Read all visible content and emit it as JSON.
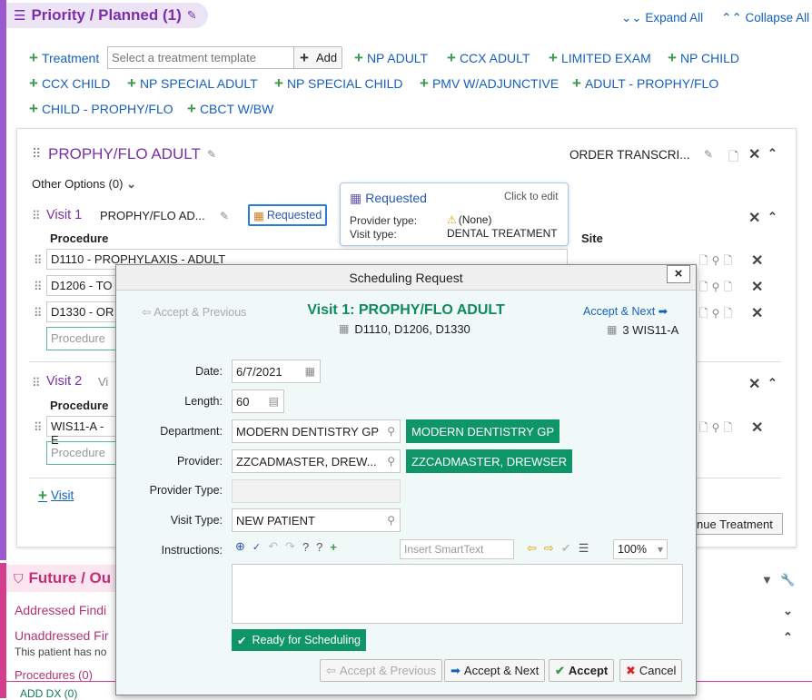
{
  "header": {
    "title": "Priority / Planned (1)",
    "expand_all": "Expand All",
    "collapse_all": "Collapse All"
  },
  "treatment": {
    "label": "Treatment",
    "placeholder": "Select a treatment template",
    "add": "Add"
  },
  "templates": [
    "NP ADULT",
    "CCX ADULT",
    "LIMITED EXAM",
    "NP CHILD",
    "CCX CHILD",
    "NP SPECIAL ADULT",
    "NP SPECIAL CHILD",
    "PMV W/ADJUNCTIVE",
    "ADULT - PROPHY/FLO",
    "CHILD - PROPHY/FLO",
    "CBCT W/BW"
  ],
  "plan": {
    "title": "PROPHY/FLO ADULT",
    "order": "ORDER TRANSCRI...",
    "other_options": "Other Options (0)"
  },
  "visit1": {
    "label": "Visit 1",
    "name": "PROPHY/FLO AD...",
    "requested": "Requested",
    "col_procedure": "Procedure",
    "col_site": "Site",
    "procedures": [
      "D1110 - PROPHYLAXIS - ADULT",
      "D1206 - TO",
      "D1330 - OR"
    ],
    "procedure_placeholder": "Procedure"
  },
  "popover": {
    "title": "Requested",
    "hint": "Click to edit",
    "provider_type_label": "Provider type:",
    "provider_type_value": "(None)",
    "visit_type_label": "Visit type:",
    "visit_type_value": "DENTAL TREATMENT"
  },
  "visit2": {
    "label": "Visit 2",
    "partial": "Vi",
    "col_procedure": "Procedure",
    "proc": "WIS11-A - E",
    "procedure_placeholder": "Procedure"
  },
  "add_visit": "Visit",
  "continue_treatment": "nue Treatment",
  "future": {
    "title": "Future / Ou",
    "addressed": "Addressed Findi",
    "unaddressed": "Unaddressed Fir",
    "note": "This patient has no",
    "procedures": "Procedures (0)",
    "add_dx": "ADD DX (0)"
  },
  "dialog": {
    "title": "Scheduling Request",
    "close": "×",
    "accept_prev": "Accept & Previous",
    "visit_title": "Visit 1: PROPHY/FLO ADULT",
    "codes": "D1110, D1206, D1330",
    "accept_next": "Accept & Next",
    "site": "3 WIS11-A",
    "date_label": "Date:",
    "date": "6/7/2021",
    "length_label": "Length:",
    "length": "60",
    "department_label": "Department:",
    "department": "MODERN DENTISTRY GP",
    "department_chip": "MODERN DENTISTRY GP",
    "provider_label": "Provider:",
    "provider": "ZZCADMASTER, DREW...",
    "provider_chip": "ZZCADMASTER, DREWSER",
    "provider_type_label": "Provider Type:",
    "visit_type_label": "Visit Type:",
    "visit_type": "NEW PATIENT",
    "instructions_label": "Instructions:",
    "smarttext_placeholder": "Insert SmartText",
    "zoom": "100%",
    "ready": "Ready for Scheduling",
    "btn_accept_prev": "Accept & Previous",
    "btn_accept_next": "Accept & Next",
    "btn_accept": "Accept",
    "btn_cancel": "Cancel"
  },
  "colors": {
    "purple": "#7b2fa8",
    "green": "#0e9669",
    "blue": "#1560bd",
    "magenta": "#c0307a"
  }
}
